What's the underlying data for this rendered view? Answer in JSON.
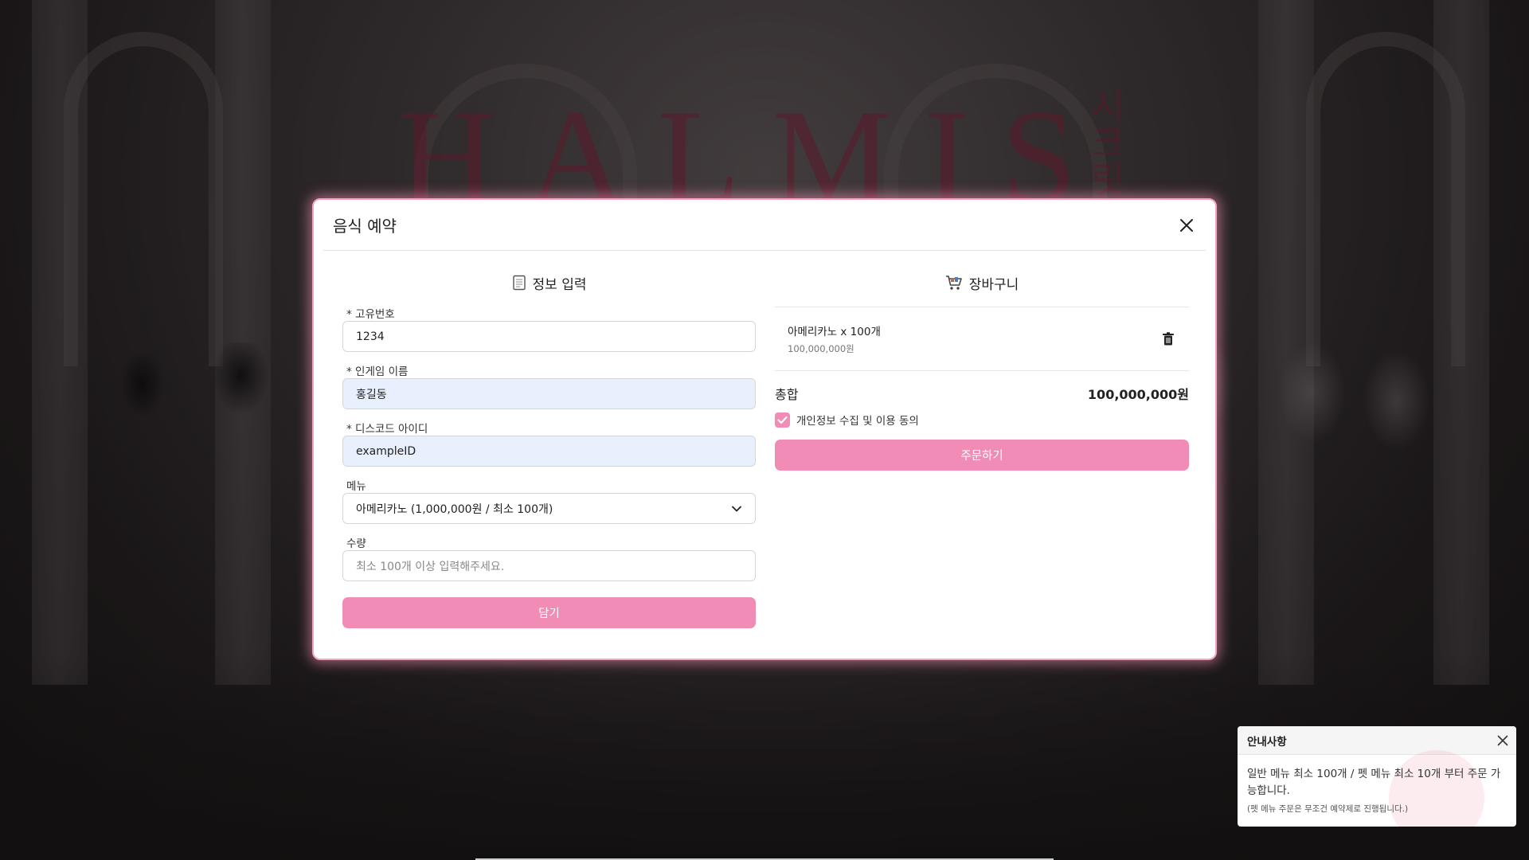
{
  "background": {
    "brand_title": "HALMIS",
    "brand_side": "시크릿멜"
  },
  "modal": {
    "title": "음식 예약",
    "left_section": {
      "title": "정보 입력",
      "icon": "notepad-icon",
      "fields": {
        "unique_id": {
          "label": "* 고유번호",
          "value": "1234"
        },
        "ingame_name": {
          "label": "* 인게임 이름",
          "value": "홍길동"
        },
        "discord_id": {
          "label": "* 디스코드 아이디",
          "value": "exampleID"
        },
        "menu": {
          "label": "메뉴",
          "value": "아메리카노 (1,000,000원 / 최소 100개)"
        },
        "quantity": {
          "label": "수량",
          "placeholder": "최소 100개 이상 입력해주세요."
        }
      },
      "add_button": "담기"
    },
    "right_section": {
      "title": "장바구니",
      "icon": "shopping-cart-icon",
      "cart_items": [
        {
          "name": "아메리카노 x 100개",
          "price": "100,000,000원"
        }
      ],
      "total_label": "총합",
      "total_value": "100,000,000원",
      "agree_label": "개인정보 수집 및 이용 동의",
      "agree_checked": true,
      "order_button": "주문하기"
    }
  },
  "notice": {
    "title": "안내사항",
    "text": "일반 메뉴 최소 100개 / 펫 메뉴 최소 10개 부터 주문 가능합니다.",
    "sub": "(펫 메뉴 주문은 무조건 예약제로 진행됩니다.)"
  },
  "colors": {
    "accent": "#f08cb5",
    "modal_border": "#f3a6c2"
  }
}
